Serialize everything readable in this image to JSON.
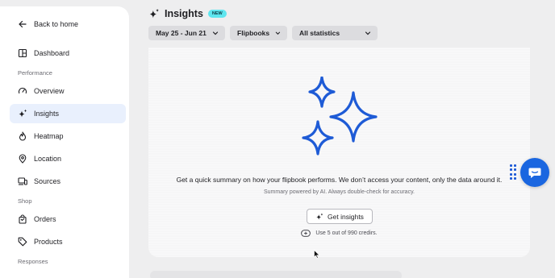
{
  "sidebar": {
    "back_label": "Back to home",
    "dashboard_label": "Dashboard",
    "sections": {
      "performance": "Performance",
      "shop": "Shop",
      "responses": "Responses"
    },
    "items": [
      {
        "label": "Overview",
        "icon": "gauge-icon"
      },
      {
        "label": "Insights",
        "icon": "sparkle-icon",
        "active": true
      },
      {
        "label": "Heatmap",
        "icon": "flame-icon"
      },
      {
        "label": "Location",
        "icon": "location-pin-icon"
      },
      {
        "label": "Sources",
        "icon": "devices-icon"
      }
    ],
    "shop_items": [
      {
        "label": "Orders",
        "icon": "shopping-bag-icon"
      },
      {
        "label": "Products",
        "icon": "tag-icon"
      }
    ]
  },
  "header": {
    "title": "Insights",
    "badge": "NEW"
  },
  "filters": {
    "date_range": "May 25 - Jun 21",
    "flipbooks": "Flipbooks",
    "statistics": "All statistics"
  },
  "main": {
    "summary_text": "Get a quick summary on how your flipbook performs. We don’t access your content, only the data around it.",
    "ai_note": "Summary powered by AI. Always double-check for accuracy.",
    "button_label": "Get insights",
    "credits_text": "Use 5 out of 990 credirs."
  },
  "colors": {
    "accent": "#1a66e0",
    "sparkle_stroke": "#1e5bd6",
    "badge_bg": "#5ee6ef",
    "active_bg": "#e9f0fd"
  }
}
